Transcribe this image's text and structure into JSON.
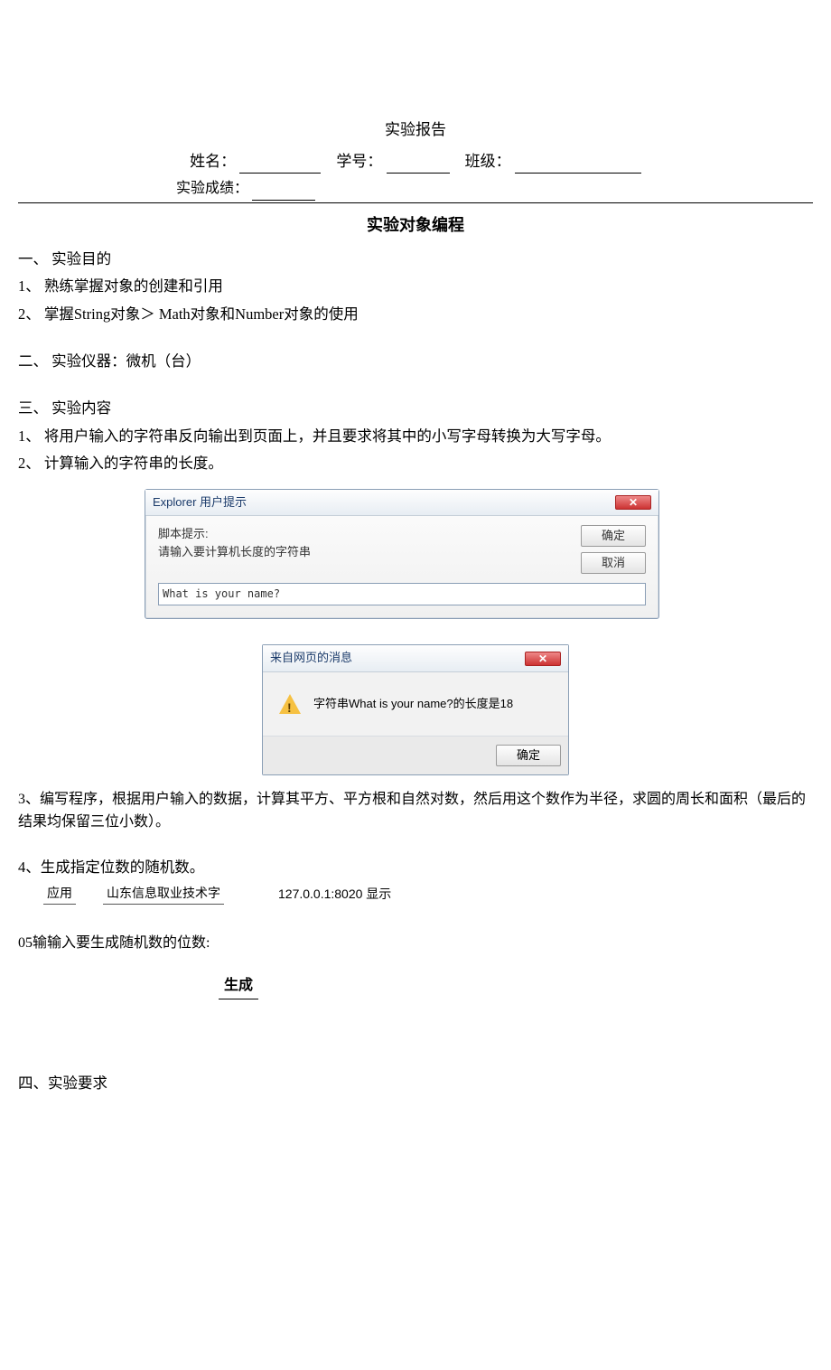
{
  "header": {
    "report_title": "实验报告",
    "name_label": "姓名：",
    "id_label": "学号：",
    "class_label": "班级：",
    "score_label": "实验成绩：",
    "main_title": "实验对象编程"
  },
  "section1": {
    "heading": "一、 实验目的",
    "item1": "1、 熟练掌握对象的创建和引用",
    "item2": "2、 掌握String对象＞ Math对象和Number对象的使用"
  },
  "section2": {
    "heading": "二、 实验仪器：微机（台）"
  },
  "section3": {
    "heading": "三、 实验内容",
    "item1": "1、 将用户输入的字符串反向输出到页面上，并且要求将其中的小写字母转换为大写字母。",
    "item2": "2、 计算输入的字符串的长度。"
  },
  "dialog1": {
    "title": "Explorer 用户提示",
    "close": "✕",
    "script_label": "脚本提示:",
    "prompt": "请输入要计算机长度的字符串",
    "input_value": "What is your name?",
    "ok": "确定",
    "cancel": "取消"
  },
  "dialog2": {
    "title": "来自网页的消息",
    "close": "✕",
    "message": "字符串What is your name?的长度是18",
    "ok": "确定"
  },
  "item3": "3、编写程序，根据用户输入的数据，计算其平方、平方根和自然对数，然后用这个数作为半径，求圆的周长和面积（最后的结果均保留三位小数）。",
  "item4": {
    "heading": "4、生成指定位数的随机数。",
    "tab_app": "应用",
    "tab_name": "山东信息取业技术字",
    "addr": "127.0.0.1:8020 显示",
    "overlap": "05输输入要生成随机数的位数:",
    "gen": "生成"
  },
  "section4": {
    "heading": "四、实验要求"
  }
}
